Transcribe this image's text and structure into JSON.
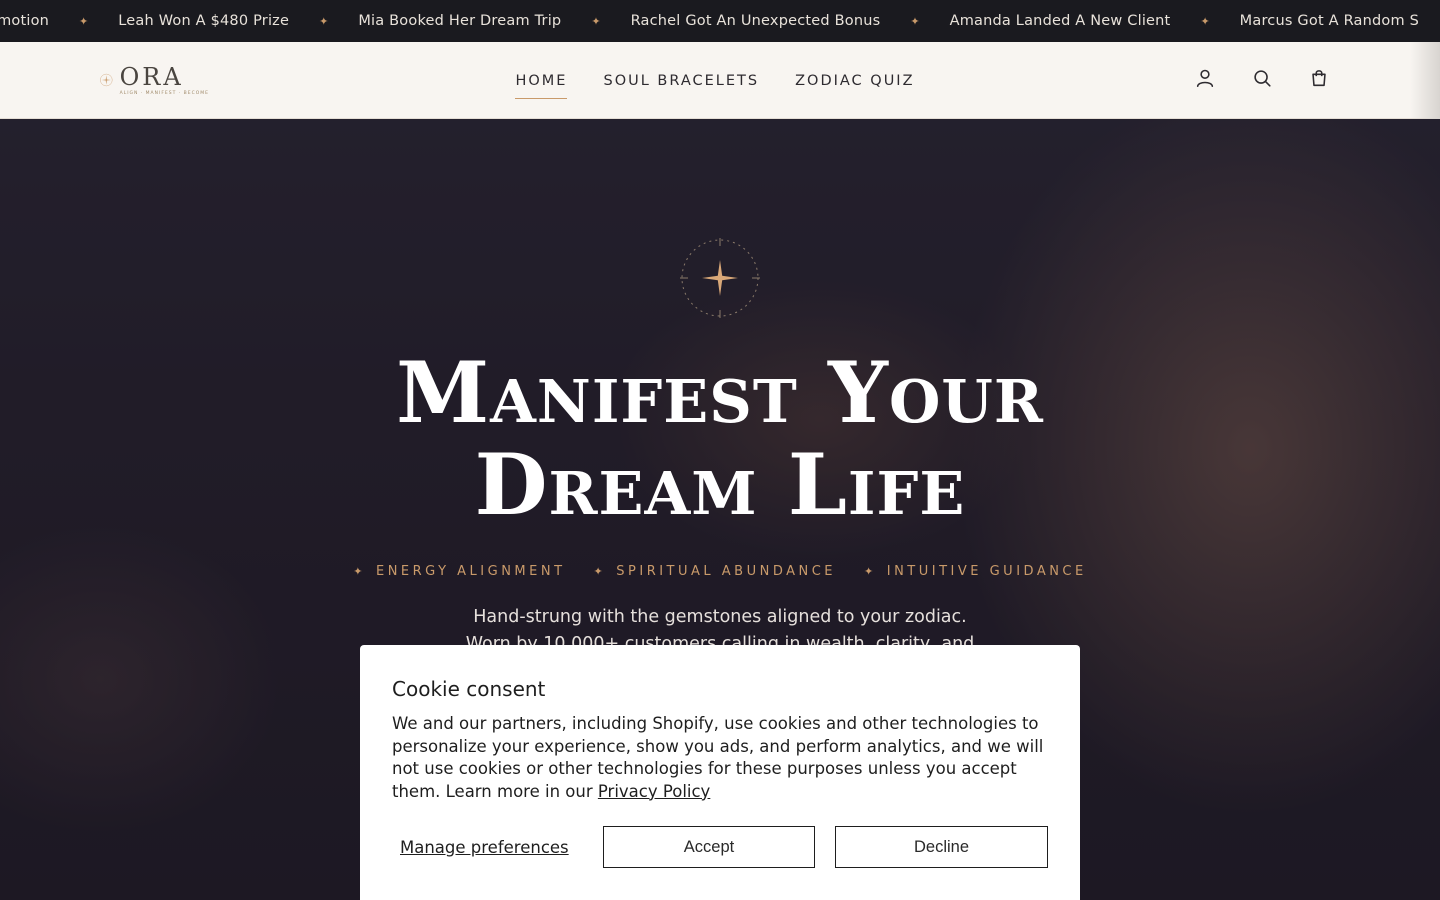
{
  "ticker": {
    "items": [
      "omotion",
      "Leah Won A $480 Prize",
      "Mia Booked Her Dream Trip",
      "Rachel Got An Unexpected Bonus",
      "Amanda Landed A New Client",
      "Marcus Got A Random S"
    ],
    "star_icon": "four-point-star"
  },
  "header": {
    "logo": {
      "word": "ORA",
      "tagline": "ALIGN · MANIFEST · BECOME"
    },
    "nav": [
      {
        "label": "HOME",
        "active": true
      },
      {
        "label": "SOUL BRACELETS",
        "active": false
      },
      {
        "label": "ZODIAC QUIZ",
        "active": false
      }
    ],
    "icons": [
      "account-icon",
      "search-icon",
      "cart-icon"
    ]
  },
  "hero": {
    "title_line1": "Manifest Your",
    "title_line2": "Dream Life",
    "tags": [
      "ENERGY ALIGNMENT",
      "SPIRITUAL ABUNDANCE",
      "INTUITIVE GUIDANCE"
    ],
    "description": "Hand-strung with the gemstones aligned to your zodiac. Worn by 10,000+ customers calling in wealth, clarity, and the life they"
  },
  "cookie": {
    "title": "Cookie consent",
    "text": "We and our partners, including Shopify, use cookies and other technologies to personalize your experience, show you ads, and perform analytics, and we will not use cookies or other technologies for these purposes unless you accept them. Learn more in our",
    "privacy_link": "Privacy Policy",
    "manage_label": "Manage preferences",
    "accept_label": "Accept",
    "decline_label": "Decline"
  },
  "colors": {
    "accent": "#c99a6a",
    "ticker_bg": "#1a1a1f",
    "header_bg": "#f8f5f1"
  }
}
